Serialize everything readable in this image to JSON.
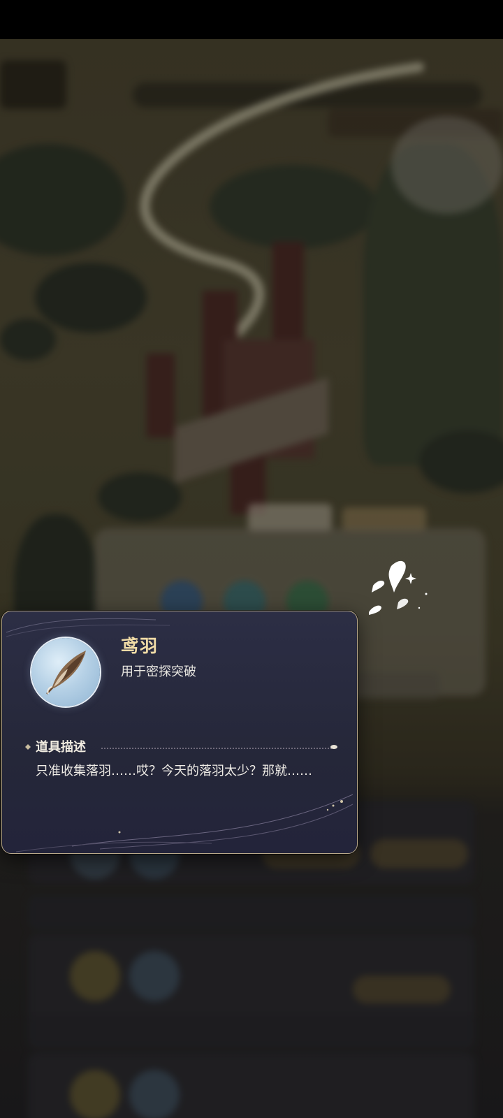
{
  "item": {
    "name": "鸢羽",
    "usage": "用于密探突破",
    "icon": "feather-icon"
  },
  "description": {
    "title": "道具描述",
    "text": "只准收集落羽……哎？今天的落羽太少？那就……"
  },
  "colors": {
    "popup_bg": "#2a2c42",
    "popup_border": "#b9a98a",
    "title_gold": "#f0dba6",
    "text": "#efece6"
  }
}
